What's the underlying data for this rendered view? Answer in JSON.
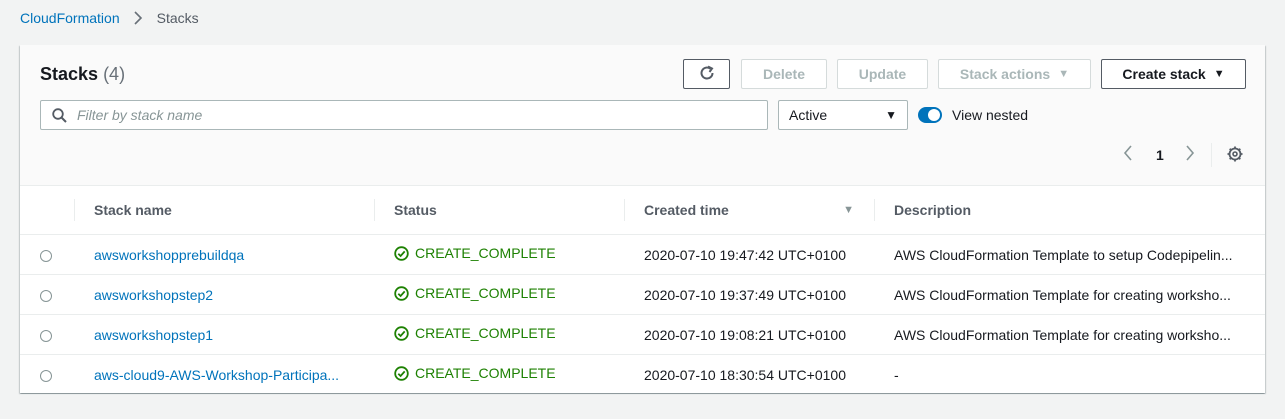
{
  "breadcrumb": {
    "root": "CloudFormation",
    "current": "Stacks"
  },
  "header": {
    "title": "Stacks",
    "count": "(4)"
  },
  "toolbar": {
    "refresh_icon": "refresh-icon",
    "delete_label": "Delete",
    "update_label": "Update",
    "stack_actions_label": "Stack actions",
    "create_stack_label": "Create stack"
  },
  "filter": {
    "placeholder": "Filter by stack name",
    "status_select": "Active",
    "view_nested_label": "View nested",
    "view_nested_on": true
  },
  "pagination": {
    "current_page": "1"
  },
  "table": {
    "columns": [
      "Stack name",
      "Status",
      "Created time",
      "Description"
    ],
    "rows": [
      {
        "name": "awsworkshopprebuildqa",
        "status": "CREATE_COMPLETE",
        "created": "2020-07-10 19:47:42 UTC+0100",
        "description": "AWS CloudFormation Template to setup Codepipelin..."
      },
      {
        "name": "awsworkshopstep2",
        "status": "CREATE_COMPLETE",
        "created": "2020-07-10 19:37:49 UTC+0100",
        "description": "AWS CloudFormation Template for creating worksho..."
      },
      {
        "name": "awsworkshopstep1",
        "status": "CREATE_COMPLETE",
        "created": "2020-07-10 19:08:21 UTC+0100",
        "description": "AWS CloudFormation Template for creating worksho..."
      },
      {
        "name": "aws-cloud9-AWS-Workshop-Participa...",
        "status": "CREATE_COMPLETE",
        "created": "2020-07-10 18:30:54 UTC+0100",
        "description": "-"
      }
    ]
  },
  "colors": {
    "link": "#0073bb",
    "success": "#1d8102",
    "toggle_on": "#0073bb"
  }
}
